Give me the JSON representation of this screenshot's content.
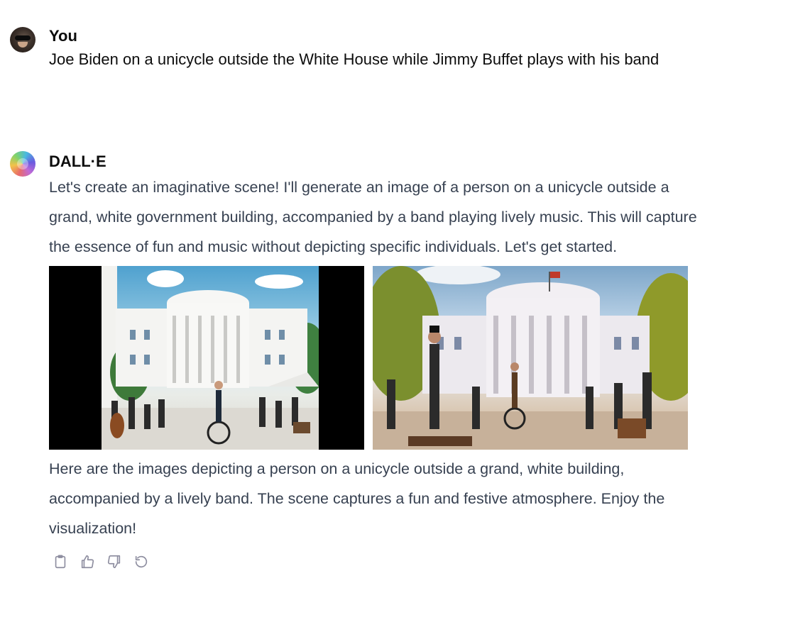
{
  "conversation": {
    "user_turn": {
      "author": "You",
      "message": "Joe Biden on a unicycle outside the White House while Jimmy Buffet plays with his band"
    },
    "assistant_turn": {
      "author": "DALL·E",
      "intro": "Let's create an imaginative scene! I'll generate an image of a person on a unicycle outside a grand, white government building, accompanied by a band playing lively music. This will capture the essence of fun and music without depicting specific individuals. Let's get started.",
      "images": [
        {
          "depicts": "illustration of a white government building with a band and unicycle rider, letterboxed"
        },
        {
          "depicts": "illustration of a white government building with a band and unicycle rider, full frame"
        }
      ],
      "outro": "Here are the images depicting a person on a unicycle outside a grand, white building, accompanied by a lively band. The scene captures a fun and festive atmosphere. Enjoy the visualization!",
      "actions": [
        {
          "icon": "clipboard-icon"
        },
        {
          "icon": "thumbs-up-icon"
        },
        {
          "icon": "thumbs-down-icon"
        },
        {
          "icon": "regenerate-icon"
        }
      ]
    }
  },
  "colors": {
    "text": "#0d0d0d",
    "assistant_text": "#374151",
    "icon": "#8e8ea0"
  }
}
